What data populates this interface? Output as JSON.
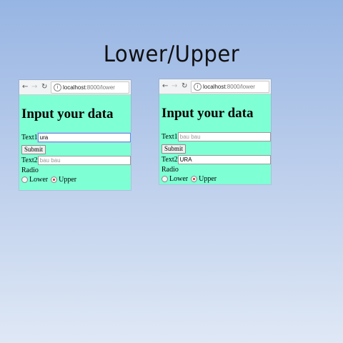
{
  "slide": {
    "title": "Lower/Upper"
  },
  "windows": [
    {
      "url_host": "localhost",
      "url_rest": ":8000/lower",
      "heading": "Input your data",
      "text1_label": "Text1",
      "text1_value": "ura",
      "submit_label": "Submit",
      "text2_label": "Text2",
      "text2_placeholder": "bau bau",
      "radio_label": "Radio",
      "opt_lower": "Lower",
      "opt_upper": "Upper",
      "selected": "Upper"
    },
    {
      "url_host": "localhost",
      "url_rest": ":8000/lower",
      "heading": "Input your data",
      "text1_label": "Text1",
      "text1_placeholder": "bau bau",
      "submit_label": "Submit",
      "text2_label": "Text2",
      "text2_value": "URA",
      "radio_label": "Radio",
      "opt_lower": "Lower",
      "opt_upper": "Upper",
      "selected": "Upper"
    }
  ],
  "icons": {
    "back": "back-arrow-icon",
    "forward": "forward-arrow-icon",
    "reload": "reload-icon",
    "info": "info-icon"
  },
  "colors": {
    "page_bg": "#7fffd4",
    "selected_radio": "#d03030"
  }
}
